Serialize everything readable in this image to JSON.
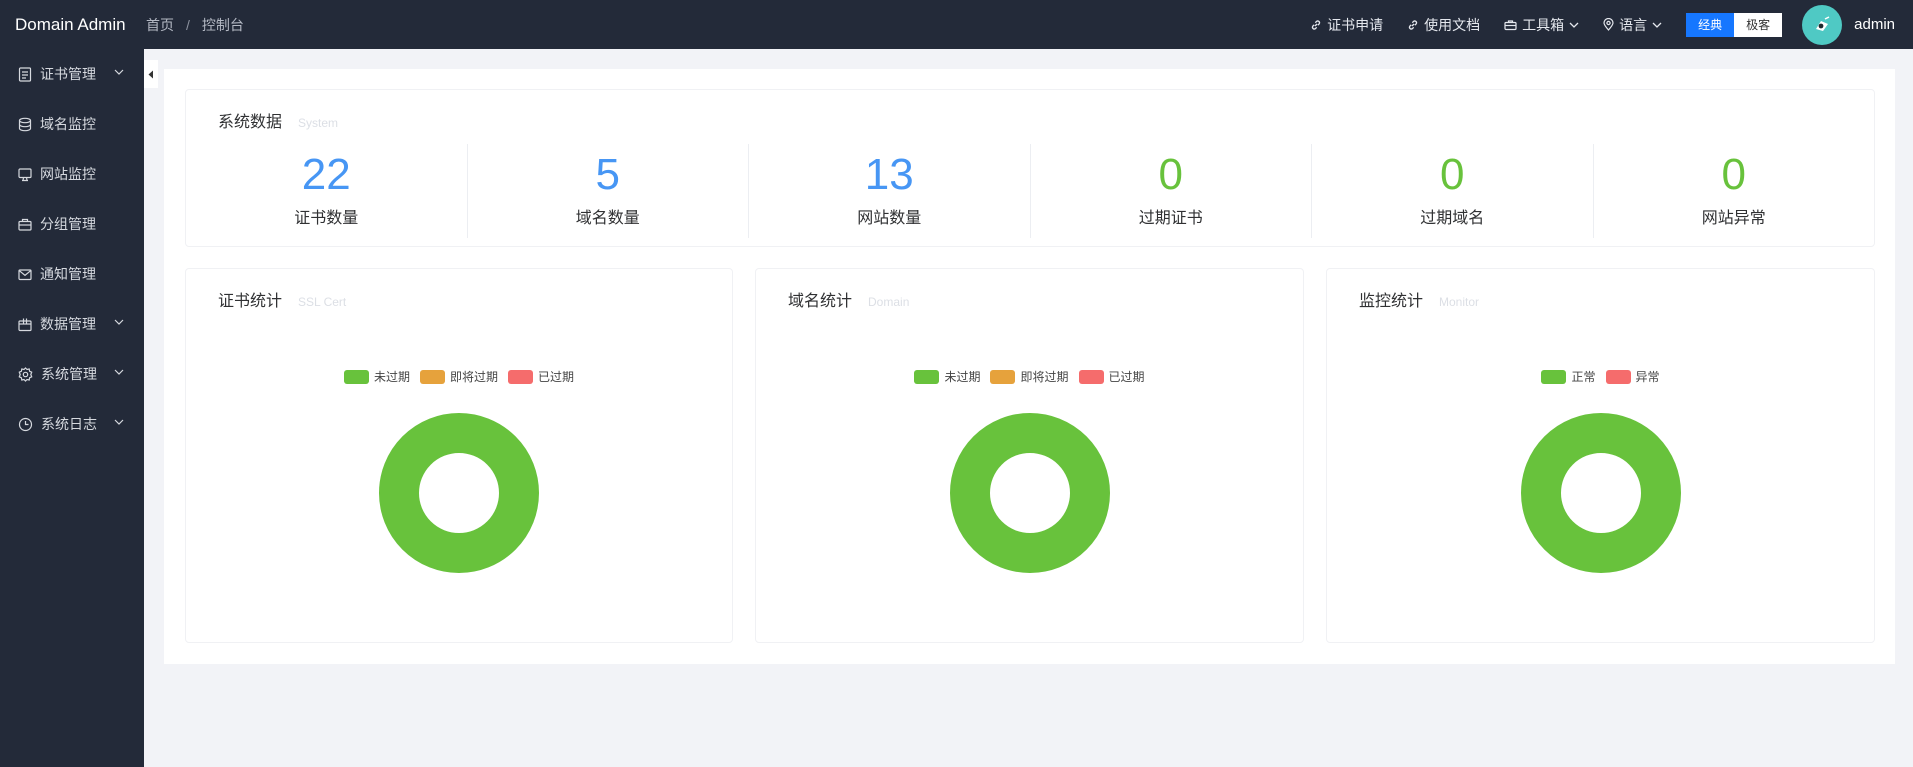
{
  "header": {
    "app_title": "Domain Admin",
    "breadcrumb": [
      "首页",
      "控制台"
    ],
    "links": {
      "cert_apply": "证书申请",
      "docs": "使用文档",
      "toolbox": "工具箱",
      "language": "语言"
    },
    "mode": {
      "classic": "经典",
      "geek": "极客"
    },
    "username": "admin"
  },
  "sidebar": {
    "items": [
      {
        "label": "证书管理",
        "icon": "document-icon",
        "has_children": true
      },
      {
        "label": "域名监控",
        "icon": "database-icon",
        "has_children": false
      },
      {
        "label": "网站监控",
        "icon": "monitor-icon",
        "has_children": false
      },
      {
        "label": "分组管理",
        "icon": "briefcase-icon",
        "has_children": false
      },
      {
        "label": "通知管理",
        "icon": "mail-icon",
        "has_children": false
      },
      {
        "label": "数据管理",
        "icon": "box-icon",
        "has_children": true
      },
      {
        "label": "系统管理",
        "icon": "gear-icon",
        "has_children": true
      },
      {
        "label": "系统日志",
        "icon": "clock-icon",
        "has_children": true
      }
    ]
  },
  "system": {
    "title": "系统数据",
    "subtitle": "System",
    "stats": [
      {
        "value": "22",
        "label": "证书数量"
      },
      {
        "value": "5",
        "label": "域名数量"
      },
      {
        "value": "13",
        "label": "网站数量"
      },
      {
        "value": "0",
        "label": "过期证书"
      },
      {
        "value": "0",
        "label": "过期域名"
      },
      {
        "value": "0",
        "label": "网站异常"
      }
    ]
  },
  "colors": {
    "green": "#68c23c",
    "orange": "#e6a23c",
    "red": "#f56c6c",
    "blue": "#4796f4",
    "accent": "#1677ff"
  },
  "chart_data": [
    {
      "type": "pie",
      "title": "证书统计",
      "subtitle": "SSL Cert",
      "categories": [
        "未过期",
        "即将过期",
        "已过期"
      ],
      "values": [
        22,
        0,
        0
      ],
      "colors": [
        "#68c23c",
        "#e6a23c",
        "#f56c6c"
      ],
      "legend": "top-center"
    },
    {
      "type": "pie",
      "title": "域名统计",
      "subtitle": "Domain",
      "categories": [
        "未过期",
        "即将过期",
        "已过期"
      ],
      "values": [
        5,
        0,
        0
      ],
      "colors": [
        "#68c23c",
        "#e6a23c",
        "#f56c6c"
      ],
      "legend": "top-center"
    },
    {
      "type": "pie",
      "title": "监控统计",
      "subtitle": "Monitor",
      "categories": [
        "正常",
        "异常"
      ],
      "values": [
        13,
        0
      ],
      "colors": [
        "#68c23c",
        "#f56c6c"
      ],
      "legend": "top-center"
    }
  ]
}
